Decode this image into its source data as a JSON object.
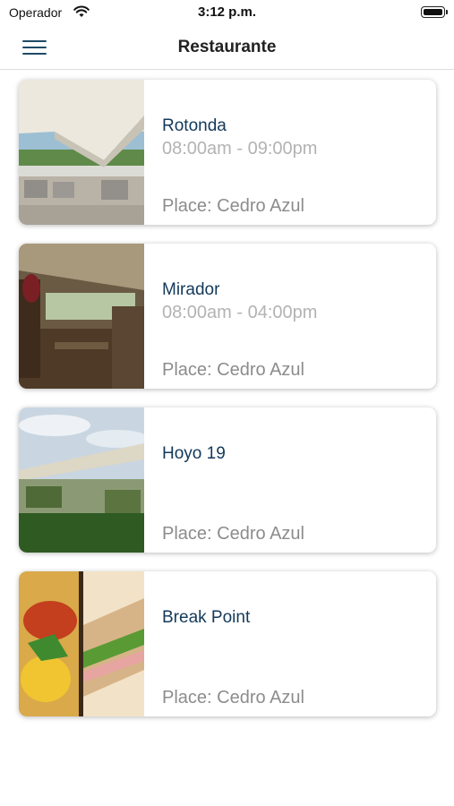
{
  "status_bar": {
    "carrier": "Operador",
    "time": "3:12 p.m."
  },
  "nav": {
    "title": "Restaurante"
  },
  "restaurants": [
    {
      "name": "Rotonda",
      "hours": "08:00am - 09:00pm",
      "place": "Place: Cedro Azul"
    },
    {
      "name": "Mirador",
      "hours": "08:00am - 04:00pm",
      "place": "Place: Cedro Azul"
    },
    {
      "name": "Hoyo 19",
      "hours": "",
      "place": "Place: Cedro Azul"
    },
    {
      "name": "Break Point",
      "hours": "",
      "place": "Place: Cedro Azul"
    }
  ],
  "colors": {
    "accent": "#13395a",
    "hours_text": "#b3b3b3",
    "place_text": "#8c8c8c"
  }
}
